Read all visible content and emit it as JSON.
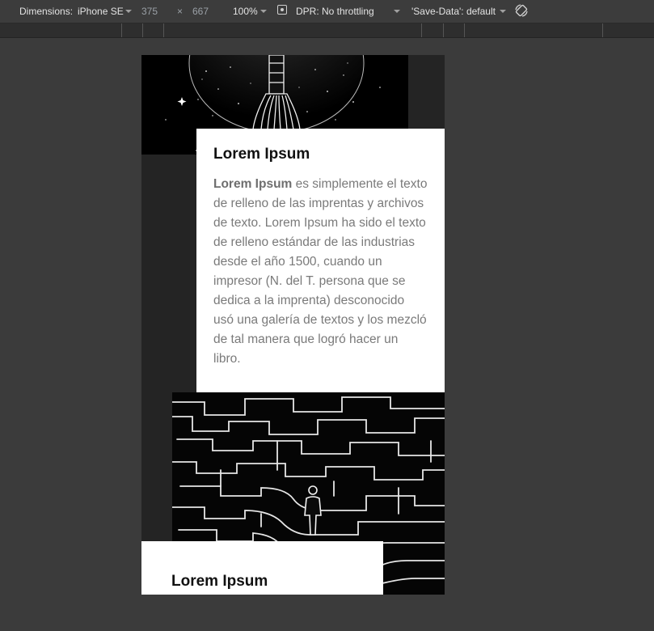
{
  "toolbar": {
    "dimensions_label": "Dimensions:",
    "device": "iPhone SE",
    "width": "375",
    "times": "×",
    "height": "667",
    "zoom": "100%",
    "dpr_label": "DPR:",
    "throttling": "No throttling",
    "save_data": "'Save-Data': default",
    "icons": [
      "caret-down-icon",
      "dpr-icon",
      "rotate-icon"
    ]
  },
  "cards": [
    {
      "title": "Lorem Ipsum",
      "body_bold": "Lorem Ipsum",
      "body_rest": " es simplemente el texto de relleno de las imprentas y archivos de texto. Lorem Ipsum ha sido el texto de relleno estándar de las industrias desde el año 1500, cuando un impresor (N. del T. persona que se dedica a la imprenta) desconocido usó una galería de textos y los mezcló de tal manera que logró hacer un libro."
    },
    {
      "title": "Lorem Ipsum"
    }
  ],
  "colors": {
    "devtools_bg": "#3b3b3b",
    "viewport_bg": "#242424",
    "card_bg": "#ffffff",
    "title_text": "#111111",
    "body_text": "#7a7a7a"
  }
}
